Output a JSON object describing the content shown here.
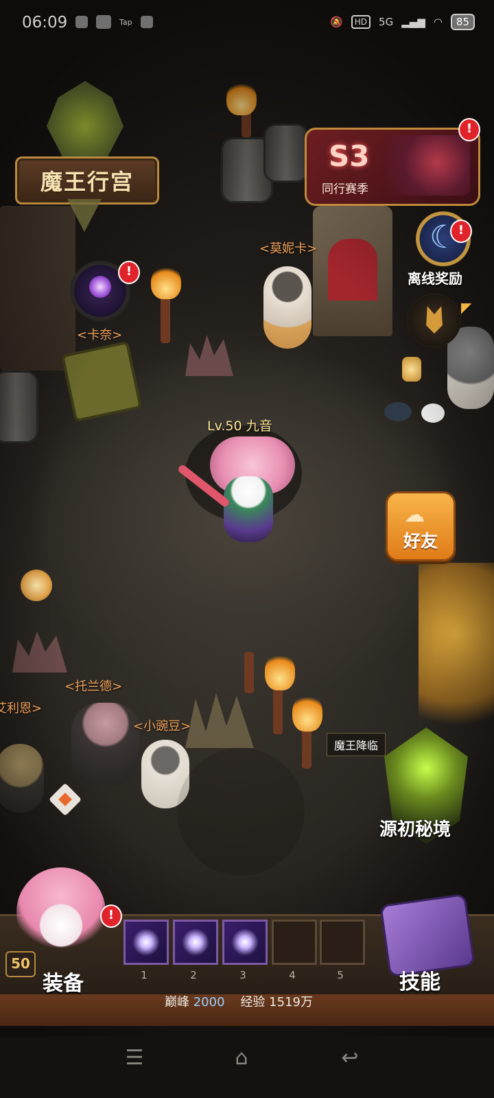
{
  "status": {
    "time": "06:09",
    "left_icons": [
      "tiktok-icon",
      "video-icon",
      "tap-icon",
      "instagram-icon"
    ],
    "tap_text": "Tap",
    "hd": "HD",
    "network": "5G",
    "battery": "85"
  },
  "header": {
    "palace_title": "魔王行宫",
    "season_code": "S3",
    "season_name": "同行赛季",
    "offline_reward": "离线奖励"
  },
  "npcs": {
    "monica": "<莫妮卡>",
    "kanai": "<卡奈>",
    "torland": "<托兰德>",
    "pea": "<小豌豆>",
    "lien": "艾利恩>"
  },
  "player": {
    "level_name": "Lv.50 九音"
  },
  "buttons": {
    "friend": "好友",
    "demon_arrival": "魔王降临",
    "origin_realm": "源初秘境"
  },
  "hud": {
    "level": "50",
    "equip": "装备",
    "skill": "技能",
    "slots": [
      "1",
      "2",
      "3",
      "4",
      "5"
    ],
    "peak_label": "巅峰",
    "peak_value": "2000",
    "exp_label": "经验",
    "exp_value": "1519万"
  },
  "badges": {
    "mark": "!"
  },
  "colors": {
    "npc_label": "#f0a15a",
    "level_label": "#ffe89a",
    "friend_button": "#f29a2e",
    "season_bg": "#6d1e22",
    "badge_red": "#e0232a"
  },
  "nav": {
    "menu_icon": "menu-icon",
    "home_icon": "home-icon",
    "back_icon": "back-icon"
  }
}
